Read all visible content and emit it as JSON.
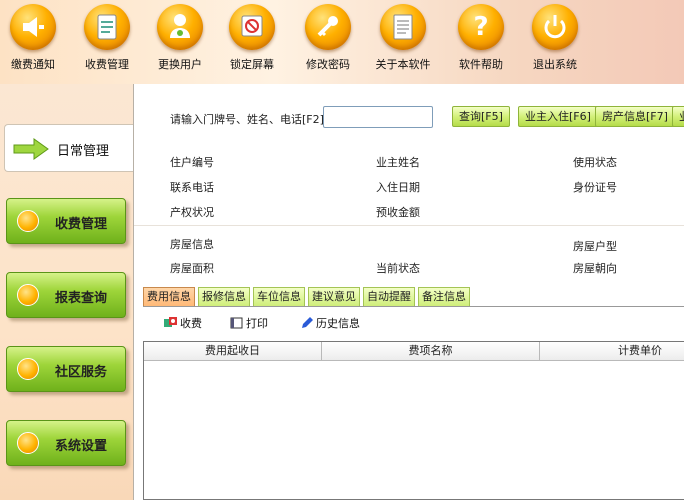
{
  "toolbar": {
    "items": [
      {
        "label": "缴费通知",
        "icon": "notice-icon"
      },
      {
        "label": "收费管理",
        "icon": "clipboard-icon"
      },
      {
        "label": "更换用户",
        "icon": "user-switch-icon"
      },
      {
        "label": "锁定屏幕",
        "icon": "lock-screen-icon"
      },
      {
        "label": "修改密码",
        "icon": "key-icon"
      },
      {
        "label": "关于本软件",
        "icon": "document-icon"
      },
      {
        "label": "软件帮助",
        "icon": "help-icon"
      },
      {
        "label": "退出系统",
        "icon": "power-icon"
      }
    ]
  },
  "sidebar": {
    "active": {
      "label": "日常管理",
      "icon": "arrow-right-icon"
    },
    "items": [
      {
        "label": "收费管理"
      },
      {
        "label": "报表查询"
      },
      {
        "label": "社区服务"
      },
      {
        "label": "系统设置"
      }
    ]
  },
  "search": {
    "label": "请输入门牌号、姓名、电话[F2]",
    "value": "",
    "buttons": {
      "query": "查询[F5]",
      "owner_checkin": "业主入住[F6]",
      "house_info": "房产信息[F7]",
      "more": "业"
    }
  },
  "info": {
    "household_no": "住户编号",
    "owner_name": "业主姓名",
    "usage_status": "使用状态",
    "phone": "联系电话",
    "checkin_date": "入住日期",
    "id_card": "身份证号",
    "property_status": "产权状况",
    "prepaid_amount": "预收金额",
    "house_info": "房屋信息",
    "house_type": "房屋户型",
    "house_area": "房屋面积",
    "current_status": "当前状态",
    "house_orientation": "房屋朝向"
  },
  "tabs": [
    {
      "label": "费用信息",
      "active": true
    },
    {
      "label": "报修信息",
      "active": false
    },
    {
      "label": "车位信息",
      "active": false
    },
    {
      "label": "建议意见",
      "active": false
    },
    {
      "label": "自动提醒",
      "active": false
    },
    {
      "label": "备注信息",
      "active": false
    }
  ],
  "actions": {
    "charge": "收费",
    "print": "打印",
    "history": "历史信息"
  },
  "grid": {
    "columns": [
      "费用起收日",
      "费项名称",
      "计费单价"
    ]
  },
  "colors": {
    "toolbar_orange": "#ffb000",
    "sidebar_green": "#9ed53a",
    "active_tab": "#ffb977"
  }
}
